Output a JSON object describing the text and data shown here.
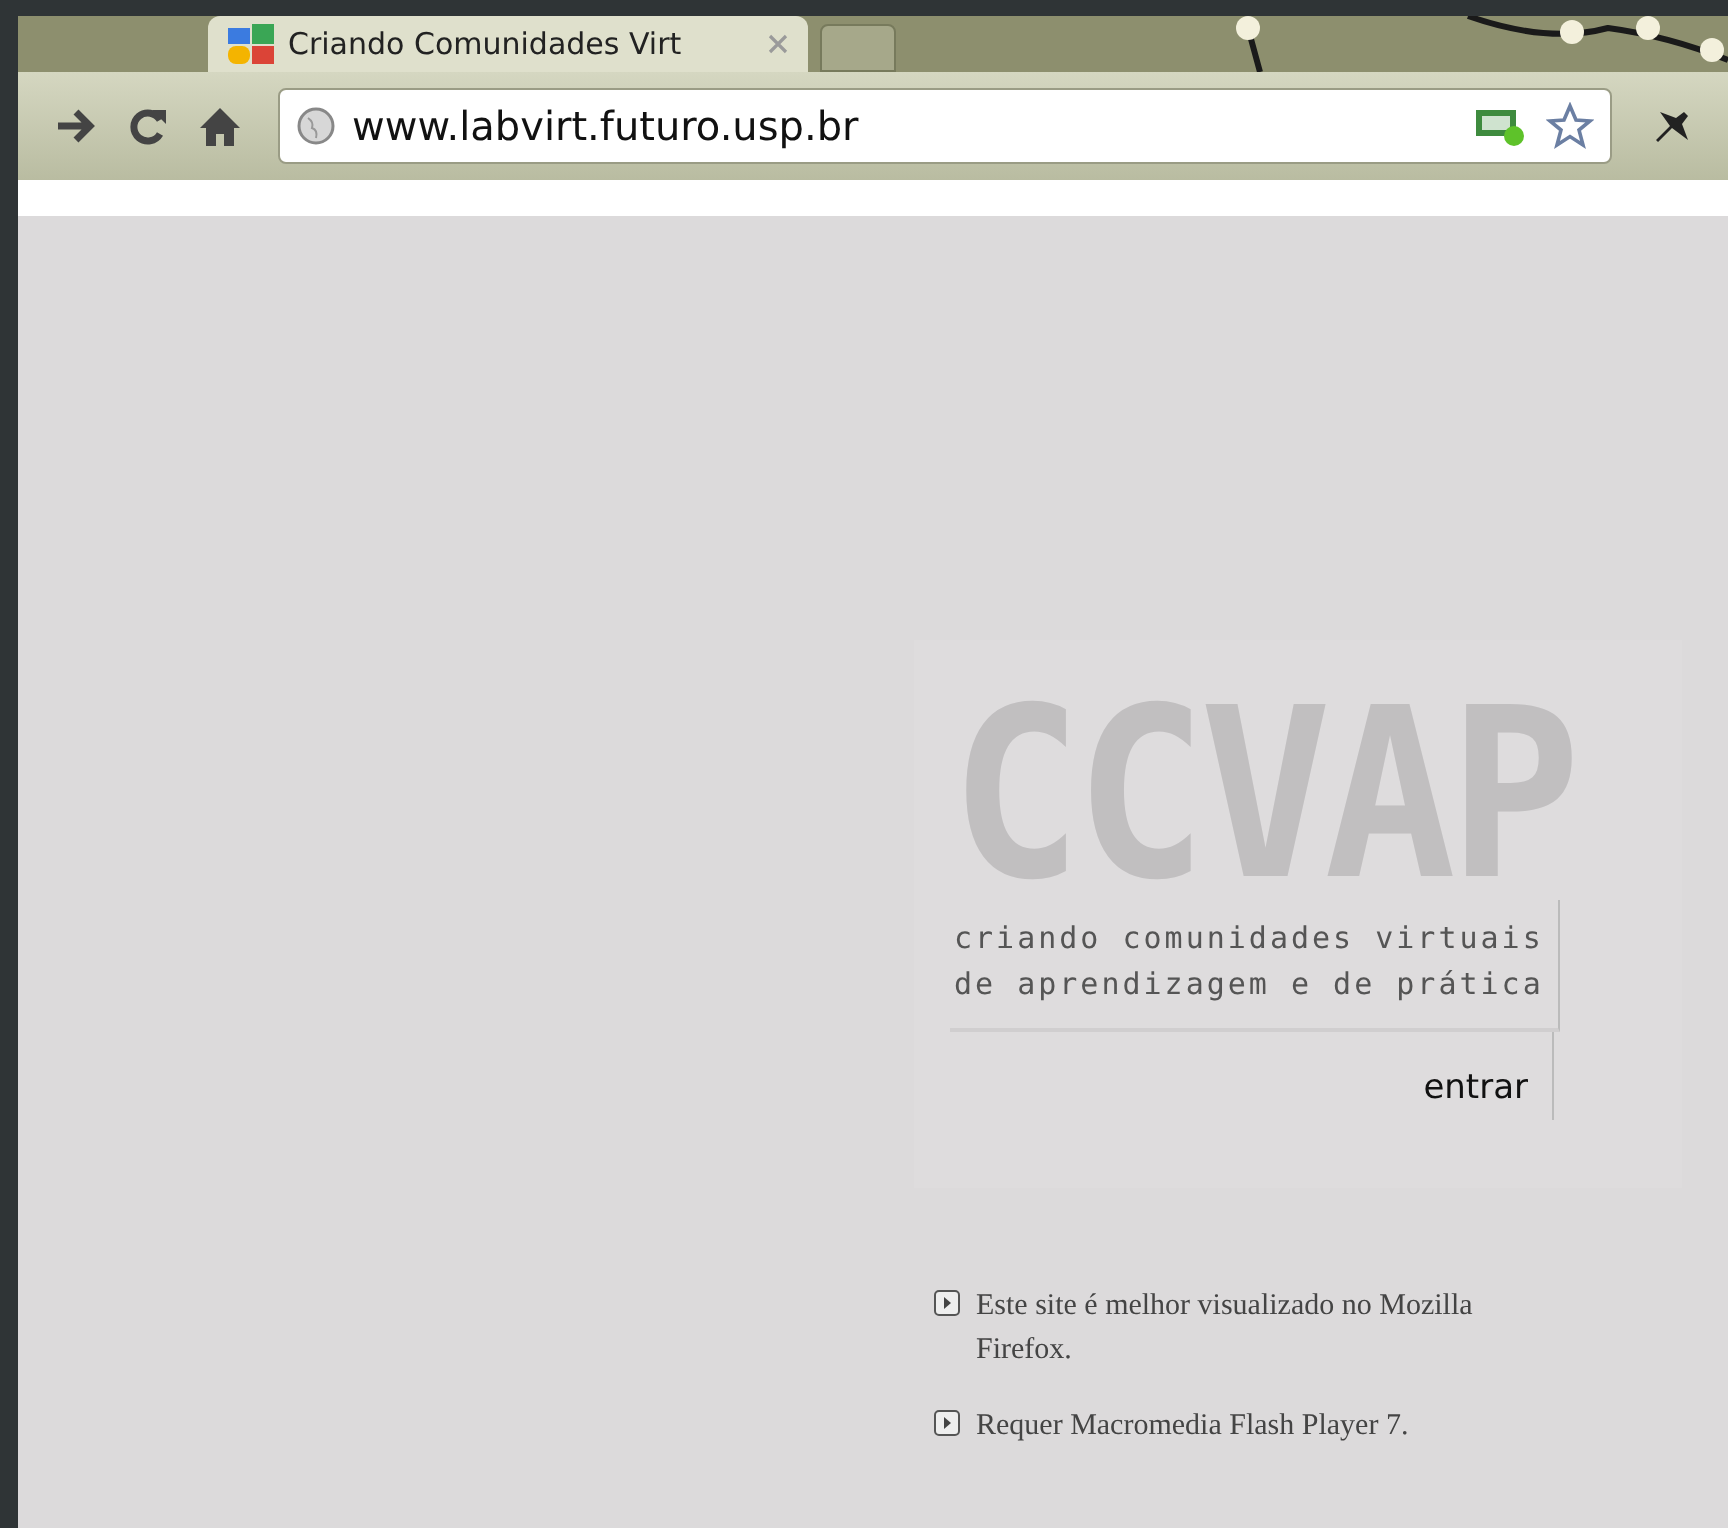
{
  "tab": {
    "title": "Criando Comunidades Virt",
    "selected": true
  },
  "address_bar": {
    "url": "www.labvirt.futuro.usp.br"
  },
  "logo": {
    "text": "CCVAP",
    "tagline_lines": [
      "criando comunidades virtuais",
      "de aprendizagem e de prática"
    ]
  },
  "enter_link": "entrar",
  "notes": [
    "Este site é melhor visualizado no Mozilla Firefox.",
    "Requer Macromedia Flash Player 7."
  ]
}
